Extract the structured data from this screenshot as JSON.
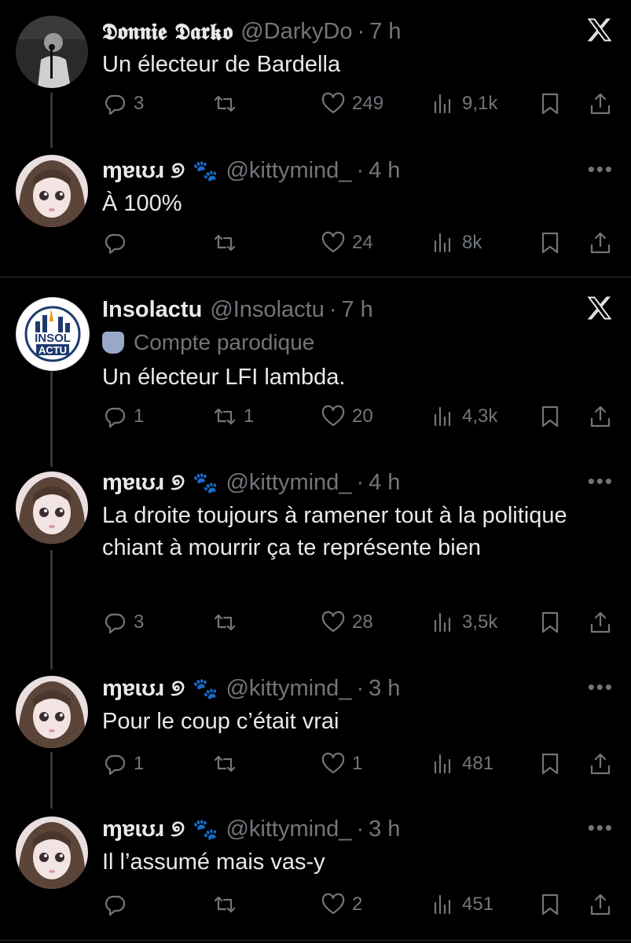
{
  "threads": [
    {
      "tweets": [
        {
          "author": "𝕯𝖔𝖓𝖓𝖎𝖊 𝕯𝖆𝖗𝖐𝖔",
          "handle": "@DarkyDo",
          "time": "7 h",
          "text": "Un électeur de Bardella",
          "replies": "3",
          "retweets": "",
          "likes": "249",
          "views": "9,1k",
          "corner": "x-logo"
        },
        {
          "author": "ɱɐɩʊɹ ୭",
          "paw": "🐾",
          "handle": "@kittymind_",
          "time": "4 h",
          "text": "À 100%",
          "replies": "",
          "retweets": "",
          "likes": "24",
          "views": "8k",
          "corner": "more"
        }
      ]
    },
    {
      "tweets": [
        {
          "author": "Insolactu",
          "handle": "@Insolactu",
          "time": "7 h",
          "label": "Compte parodique",
          "avatar_text": [
            "INSOL",
            "ACTU"
          ],
          "text": "Un électeur LFI lambda.",
          "replies": "1",
          "retweets": "1",
          "likes": "20",
          "views": "4,3k",
          "corner": "x-logo"
        },
        {
          "author": "ɱɐɩʊɹ ୭",
          "paw": "🐾",
          "handle": "@kittymind_",
          "time": "4 h",
          "text": "La droite toujours à ramener tout à la politique chiant à mourrir ça te représente bien",
          "replies": "3",
          "retweets": "",
          "likes": "28",
          "views": "3,5k",
          "corner": "more"
        },
        {
          "author": "ɱɐɩʊɹ ୭",
          "paw": "🐾",
          "handle": "@kittymind_",
          "time": "3 h",
          "text": "Pour le coup c’était vrai",
          "replies": "1",
          "retweets": "",
          "likes": "1",
          "views": "481",
          "corner": "more"
        },
        {
          "author": "ɱɐɩʊɹ ୭",
          "paw": "🐾",
          "handle": "@kittymind_",
          "time": "3 h",
          "text": "Il l’assumé mais vas-y",
          "replies": "",
          "retweets": "",
          "likes": "2",
          "views": "451",
          "corner": "more"
        }
      ]
    }
  ],
  "icons": {
    "reply": "reply-icon",
    "retweet": "retweet-icon",
    "like": "heart-icon",
    "views": "views-icon",
    "bookmark": "bookmark-icon",
    "share": "share-icon",
    "corner_x": "x-logo-icon",
    "corner_more": "more-icon",
    "parody": "theater-mask-icon"
  },
  "colors": {
    "background": "#000000",
    "text": "#e7e9ea",
    "muted": "#71767b",
    "divider": "#2f3336"
  }
}
